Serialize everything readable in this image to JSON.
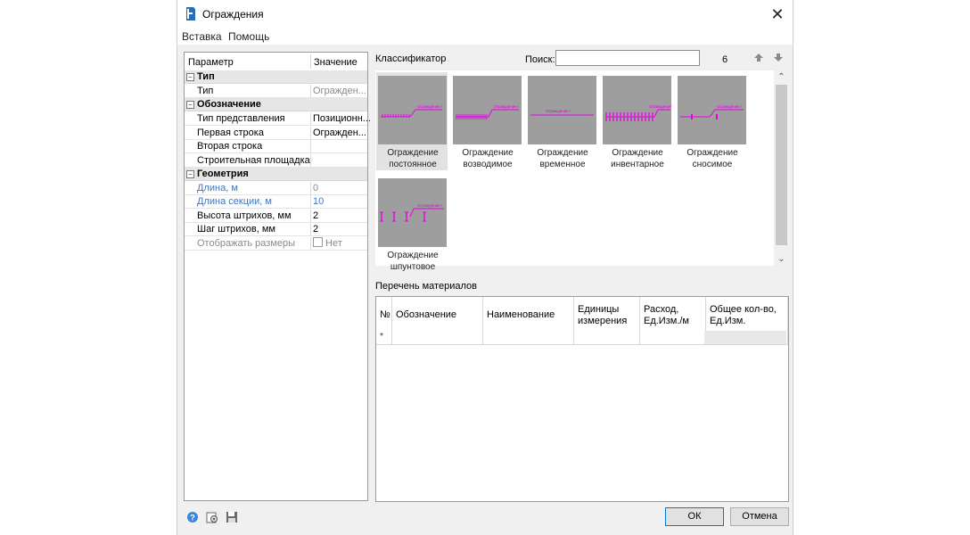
{
  "window": {
    "title": "Ограждения",
    "close_glyph": "✕"
  },
  "menu": [
    "Вставка",
    "Помощь"
  ],
  "params": {
    "header": {
      "name": "Параметр",
      "value": "Значение"
    },
    "rows": [
      {
        "kind": "cat",
        "toggle": "⊟",
        "name": "Тип"
      },
      {
        "kind": "row",
        "name": "Тип",
        "value": "Огражден...",
        "value_style": "gray"
      },
      {
        "kind": "cat",
        "toggle": "⊟",
        "name": "Обозначение"
      },
      {
        "kind": "row",
        "name": "Тип представления",
        "value": "Позиционн..."
      },
      {
        "kind": "row",
        "name": "Первая строка",
        "value": "Огражден..."
      },
      {
        "kind": "row",
        "name": "Вторая строка",
        "value": ""
      },
      {
        "kind": "row",
        "name": "Строительная площадка",
        "value": ""
      },
      {
        "kind": "cat",
        "toggle": "⊟",
        "name": "Геометрия"
      },
      {
        "kind": "row",
        "name": "Длина, м",
        "value": "0",
        "name_style": "blue",
        "value_style": "gray"
      },
      {
        "kind": "row",
        "name": "Длина секции, м",
        "value": "10",
        "name_style": "blue",
        "value_style": "blue"
      },
      {
        "kind": "row",
        "name": "Высота штрихов, мм",
        "value": "2"
      },
      {
        "kind": "row",
        "name": "Шаг штрихов, мм",
        "value": "2"
      },
      {
        "kind": "row",
        "name": "Отображать размеры",
        "value": "Нет",
        "checkbox": true,
        "name_style": "gray",
        "value_style": "gray"
      }
    ]
  },
  "classifier": {
    "label": "Классификатор",
    "search_label": "Поиск:",
    "search_value": "",
    "count": "6",
    "items": [
      {
        "line1": "Ограждение",
        "line2": "постоянное",
        "icon": "fence-permanent-icon",
        "selected": true
      },
      {
        "line1": "Ограждение",
        "line2": "возводимое",
        "icon": "fence-erected-icon"
      },
      {
        "line1": "Ограждение",
        "line2": "временное",
        "icon": "fence-temporary-icon"
      },
      {
        "line1": "Ограждение",
        "line2": "инвентарное",
        "icon": "fence-inventory-icon"
      },
      {
        "line1": "Ограждение",
        "line2": "сносимое",
        "icon": "fence-demolished-icon"
      },
      {
        "line1": "Ограждение",
        "line2": "шпунтовое",
        "icon": "fence-sheet-pile-icon"
      }
    ],
    "thumb_caption": "Ограждение !"
  },
  "materials": {
    "label": "Перечень материалов",
    "columns": [
      {
        "l1": "№",
        "l2": ""
      },
      {
        "l1": "Обозначение",
        "l2": ""
      },
      {
        "l1": "Наименование",
        "l2": ""
      },
      {
        "l1": "Единицы",
        "l2": "измерения"
      },
      {
        "l1": "Расход,",
        "l2": "Ед.Изм./м"
      },
      {
        "l1": "Общее кол-во,",
        "l2": "Ед.Изм."
      }
    ],
    "new_row_marker": "*"
  },
  "buttons": {
    "ok": "ОК",
    "cancel": "Отмена"
  },
  "colors": {
    "accent": "#0078d7",
    "magenta": "#e600e6",
    "thumb_bg": "#9e9e9e"
  }
}
